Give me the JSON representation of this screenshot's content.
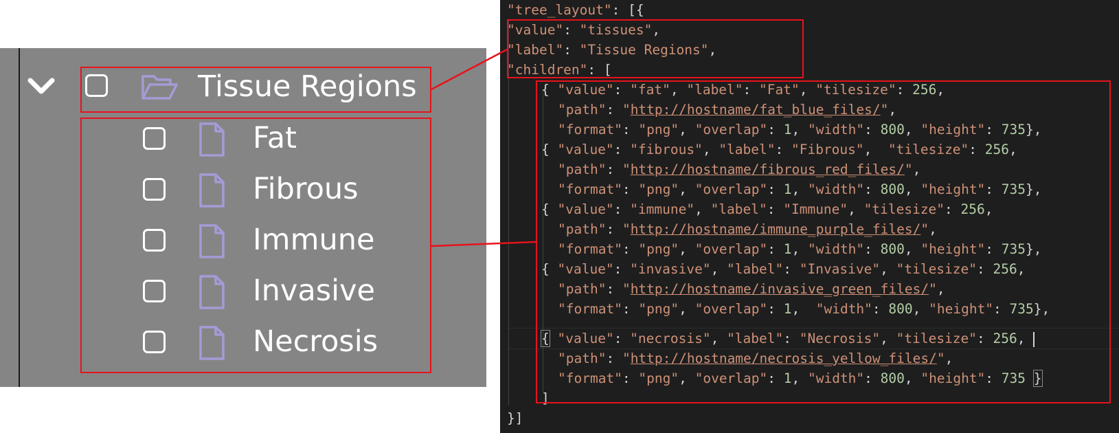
{
  "tree": {
    "parent": {
      "label": "Tissue Regions",
      "icon": "folder-open-icon",
      "expand_icon": "chevron-down-icon"
    },
    "children": [
      {
        "label": "Fat",
        "icon": "file-icon"
      },
      {
        "label": "Fibrous",
        "icon": "file-icon"
      },
      {
        "label": "Immune",
        "icon": "file-icon"
      },
      {
        "label": "Invasive",
        "icon": "file-icon"
      },
      {
        "label": "Necrosis",
        "icon": "file-icon"
      }
    ]
  },
  "code": {
    "lines": [
      "\"tree_layout\": [{",
      "\"value\": \"tissues\",",
      "\"label\": \"Tissue Regions\",",
      "\"children\": [",
      "    { \"value\": \"fat\", \"label\": \"Fat\", \"tilesize\": 256,",
      "      \"path\": \"http://hostname/fat_blue_files/\",",
      "      \"format\": \"png\", \"overlap\": 1, \"width\": 800, \"height\": 735},",
      "    { \"value\": \"fibrous\", \"label\": \"Fibrous\",  \"tilesize\": 256,",
      "      \"path\": \"http://hostname/fibrous_red_files/\",",
      "      \"format\": \"png\", \"overlap\": 1, \"width\": 800, \"height\": 735},",
      "    { \"value\": \"immune\", \"label\": \"Immune\", \"tilesize\": 256,",
      "      \"path\": \"http://hostname/immune_purple_files/\",",
      "      \"format\": \"png\", \"overlap\": 1, \"width\": 800, \"height\": 735},",
      "    { \"value\": \"invasive\", \"label\": \"Invasive\", \"tilesize\": 256,",
      "      \"path\": \"http://hostname/invasive_green_files/\",",
      "      \"format\": \"png\", \"overlap\": 1,  \"width\": 800, \"height\": 735},",
      "    { \"value\": \"necrosis\", \"label\": \"Necrosis\", \"tilesize\": 256, ",
      "      \"path\": \"http://hostname/necrosis_yellow_files/\",",
      "      \"format\": \"png\", \"overlap\": 1, \"width\": 800, \"height\": 735 }",
      "    ]",
      "}]"
    ]
  },
  "colors": {
    "panel_bg": "#858585",
    "icon_color": "#a59bd6",
    "highlight_red": "#e8121b",
    "code_bg": "#1e1e1e",
    "code_string": "#ce9178",
    "code_number": "#b5cea8"
  }
}
